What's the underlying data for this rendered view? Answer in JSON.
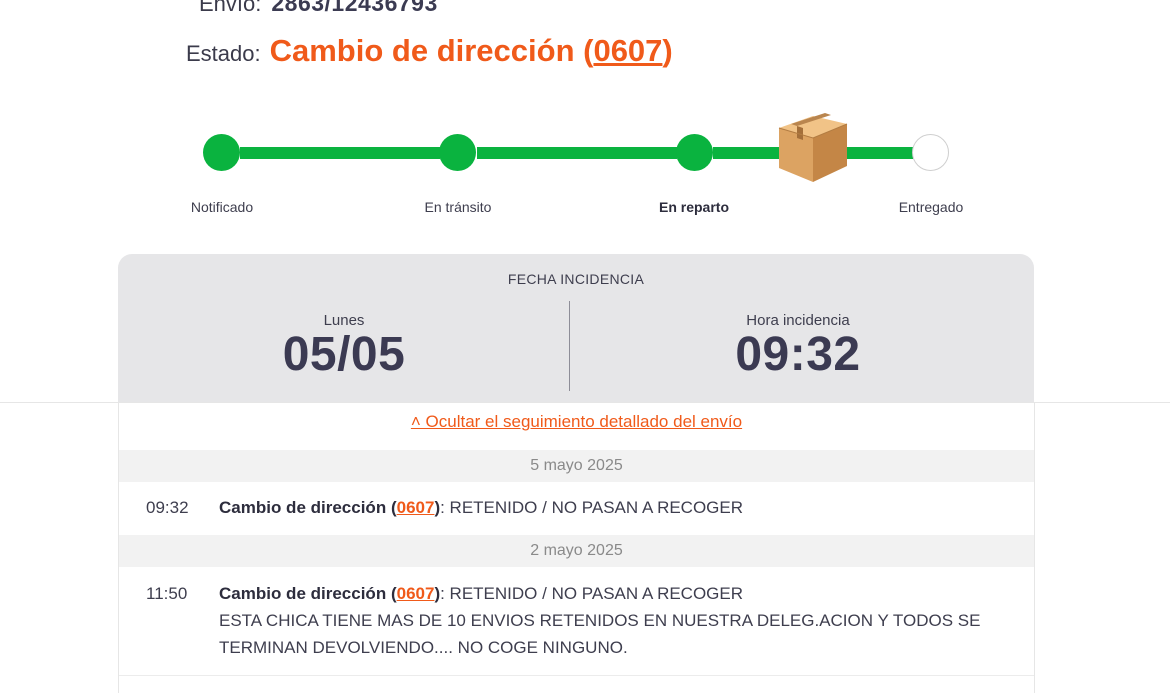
{
  "header": {
    "envio_label": "Envío:",
    "envio_value": "2863/12436793",
    "estado_label": "Estado:",
    "estado_status": "Cambio de dirección",
    "estado_code": "0607",
    "status_color": "#f05a1a"
  },
  "tracker": {
    "steps": [
      {
        "label": "Notificado",
        "state": "done"
      },
      {
        "label": "En tránsito",
        "state": "done"
      },
      {
        "label": "En reparto",
        "state": "current"
      },
      {
        "label": "Entregado",
        "state": "pending"
      }
    ],
    "progress_color": "#0ab33f",
    "current_icon": "package-box-icon"
  },
  "incidencia": {
    "title": "FECHA INCIDENCIA",
    "day_label": "Lunes",
    "date": "05/05",
    "time_label": "Hora incidencia",
    "time": "09:32"
  },
  "detail": {
    "hide_link": "˄ Ocultar el seguimiento detallado del envío",
    "groups": [
      {
        "date": "5 mayo 2025",
        "events": [
          {
            "time": "09:32",
            "status": "Cambio de dirección",
            "code": "0607",
            "text": ": RETENIDO / NO PASAN A RECOGER",
            "note": ""
          }
        ]
      },
      {
        "date": "2 mayo 2025",
        "events": [
          {
            "time": "11:50",
            "status": "Cambio de dirección",
            "code": "0607",
            "text": ": RETENIDO / NO PASAN A RECOGER",
            "note": "ESTA CHICA TIENE MAS DE 10 ENVIOS RETENIDOS EN NUESTRA DELEG.ACION Y TODOS SE TERMINAN DEVOLVIENDO.... NO COGE NINGUNO."
          }
        ]
      }
    ]
  }
}
